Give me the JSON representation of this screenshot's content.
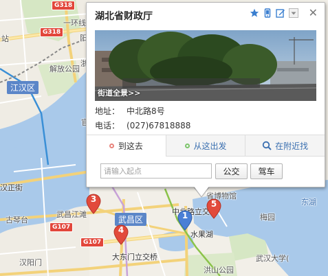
{
  "map": {
    "road_shields": [
      "G318",
      "G318",
      "G107",
      "G107"
    ],
    "district_labels": [
      "江汉区",
      "武昌区"
    ],
    "labels": {
      "zhan": "站",
      "yihuan_road": "一环线",
      "jiefang_park": "解放公园",
      "hanzheng_st": "汉正街",
      "guqintai": "古琴台",
      "wuchang_riverbank": "武昌江滩",
      "dadongmen": "大东门立交桥",
      "zhongbei_road": "中北路立交",
      "shuiguohu": "水果湖",
      "provincial_museum": "省博物馆",
      "donghu": "东湖",
      "meiyuan": "梅园",
      "hongshan": "洪山公园",
      "whu": "武汉大学(",
      "hanyang": "汉阳门",
      "zhe": "浙",
      "yang": "阳",
      "guan": "官"
    },
    "markers": [
      {
        "number": "1",
        "color": "#4a7fd6"
      },
      {
        "number": "3",
        "color": "#e24a3b"
      },
      {
        "number": "4",
        "color": "#e24a3b"
      },
      {
        "number": "5",
        "color": "#e24a3b"
      }
    ]
  },
  "popup": {
    "title": "湖北省财政厅",
    "header_icons": [
      "star-icon",
      "phone-icon",
      "edit-icon",
      "dropdown-icon"
    ],
    "close_symbol": "✕",
    "photo_caption": "街道全景>>",
    "address_label": "地址：",
    "address_value": "中北路8号",
    "phone_label": "电话：",
    "phone_value": "(027)67818888",
    "tabs": [
      {
        "label": "到这去",
        "dot_color": "#e8837b"
      },
      {
        "label": "从这出发",
        "dot_color": "#7cc56b"
      },
      {
        "label": "在附近找",
        "icon": "search-icon"
      }
    ],
    "start_placeholder": "请输入起点",
    "bus_button": "公交",
    "drive_button": "驾车"
  }
}
